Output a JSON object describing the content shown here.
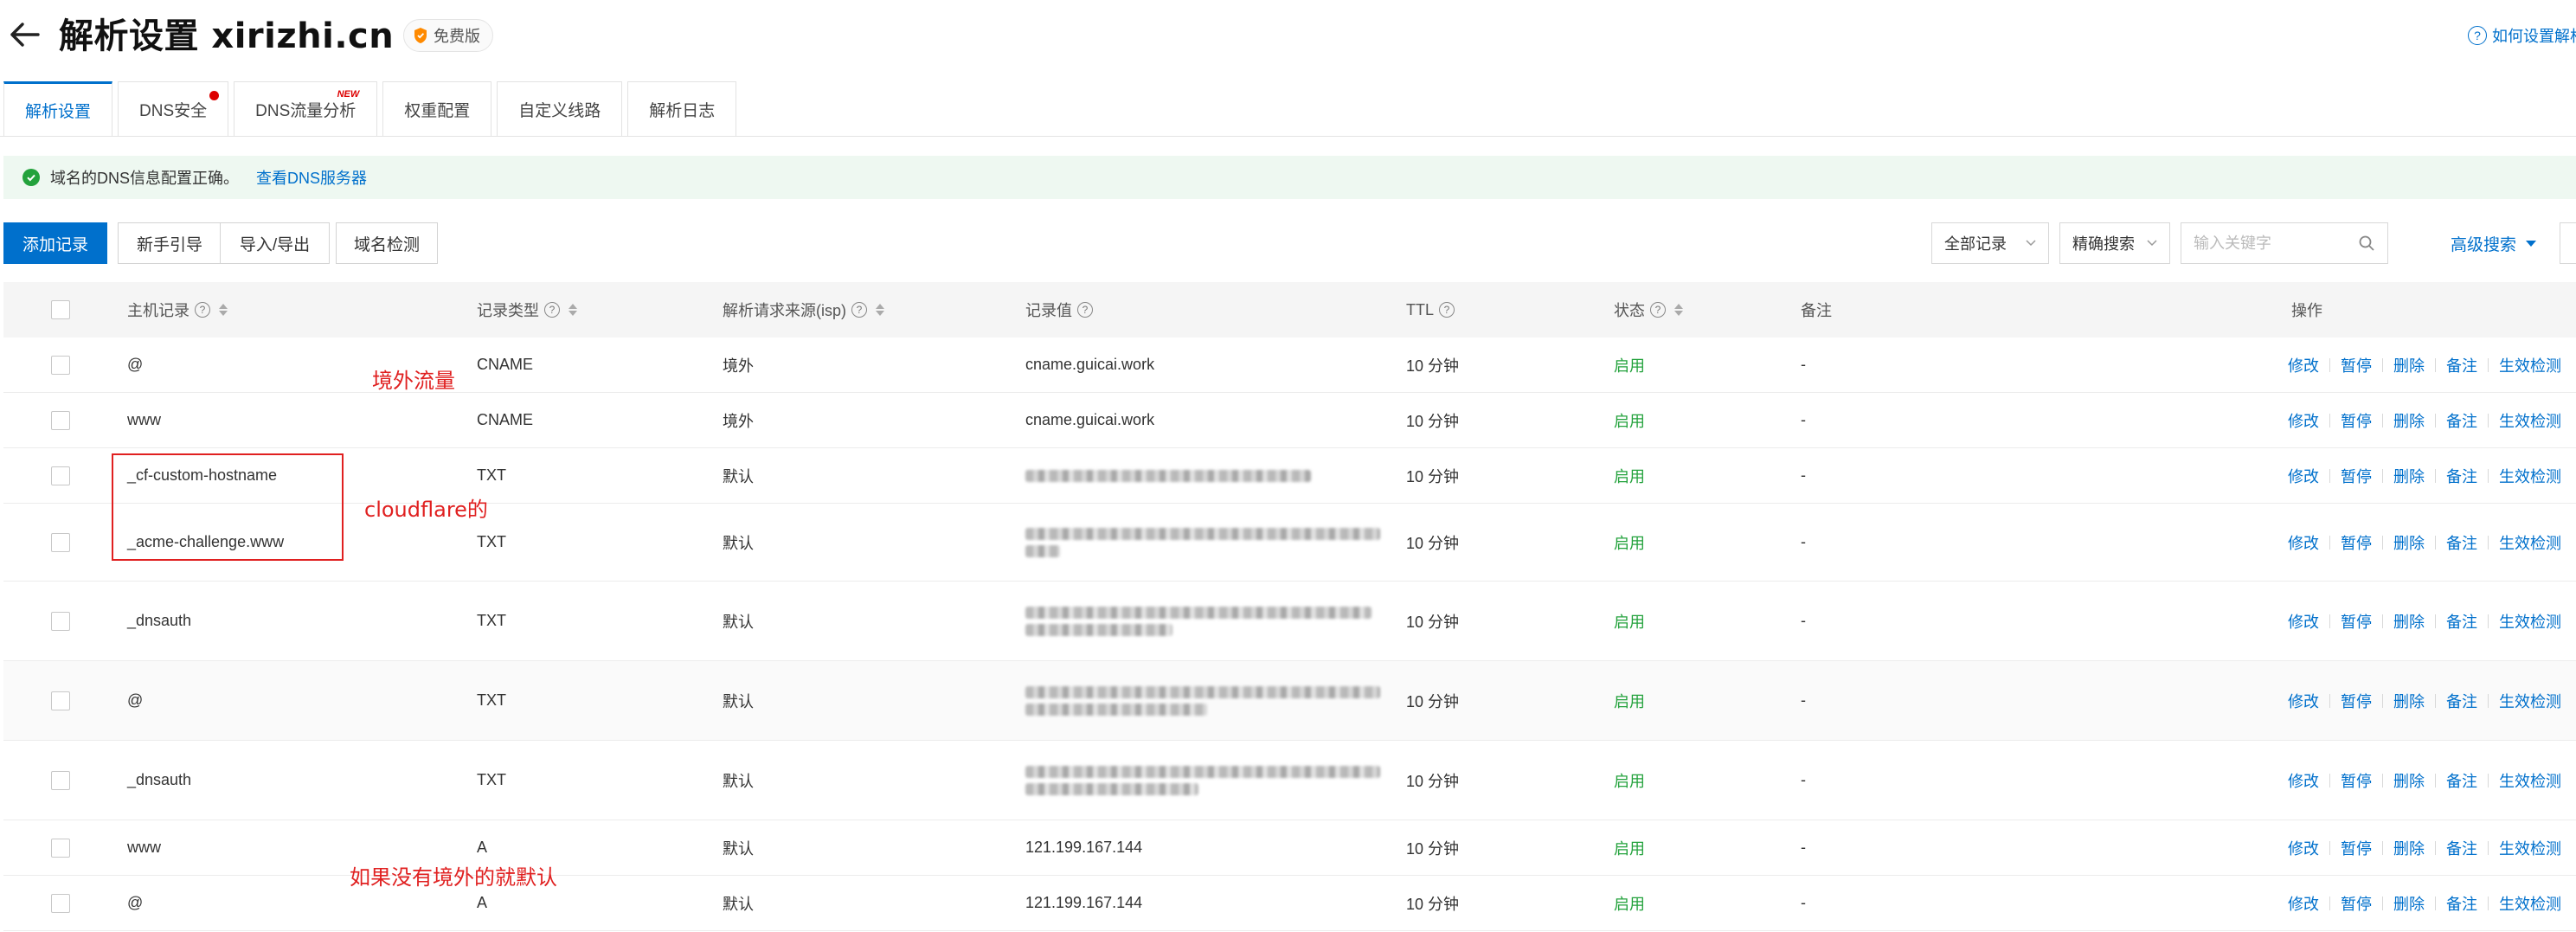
{
  "header": {
    "title": "解析设置 xirizhi.cn",
    "badge": "免费版",
    "help_link": "如何设置解析"
  },
  "tabs": [
    {
      "label": "解析设置",
      "active": true
    },
    {
      "label": "DNS安全",
      "dot": true
    },
    {
      "label": "DNS流量分析",
      "tag": "NEW"
    },
    {
      "label": "权重配置"
    },
    {
      "label": "自定义线路"
    },
    {
      "label": "解析日志"
    }
  ],
  "alert": {
    "text": "域名的DNS信息配置正确。",
    "link": "查看DNS服务器"
  },
  "toolbar": {
    "add": "添加记录",
    "guide": "新手引导",
    "import_export": "导入/导出",
    "check": "域名检测",
    "filter_all": "全部记录",
    "precise_search": "精确搜索",
    "search_placeholder": "输入关键字",
    "advanced_search": "高级搜索"
  },
  "table": {
    "headers": {
      "host": "主机记录",
      "type": "记录类型",
      "source": "解析请求来源(isp)",
      "value": "记录值",
      "ttl": "TTL",
      "status": "状态",
      "remark": "备注",
      "ops": "操作"
    },
    "ops": [
      "修改",
      "暂停",
      "删除",
      "备注",
      "生效检测"
    ],
    "rows": [
      {
        "host": "@",
        "type": "CNAME",
        "source": "境外",
        "value": "cname.guicai.work",
        "ttl": "10 分钟",
        "status": "启用",
        "remark": "-"
      },
      {
        "host": "www",
        "type": "CNAME",
        "source": "境外",
        "value": "cname.guicai.work",
        "ttl": "10 分钟",
        "status": "启用",
        "remark": "-"
      },
      {
        "host": "_cf-custom-hostname",
        "type": "TXT",
        "source": "默认",
        "value": "",
        "ttl": "10 分钟",
        "status": "启用",
        "remark": "-"
      },
      {
        "host": "_acme-challenge.www",
        "type": "TXT",
        "source": "默认",
        "value": "",
        "ttl": "10 分钟",
        "status": "启用",
        "remark": "-"
      },
      {
        "host": "_dnsauth",
        "type": "TXT",
        "source": "默认",
        "value": "",
        "ttl": "10 分钟",
        "status": "启用",
        "remark": "-"
      },
      {
        "host": "@",
        "type": "TXT",
        "source": "默认",
        "value": "",
        "ttl": "10 分钟",
        "status": "启用",
        "remark": "-"
      },
      {
        "host": "_dnsauth",
        "type": "TXT",
        "source": "默认",
        "value": "",
        "ttl": "10 分钟",
        "status": "启用",
        "remark": "-"
      },
      {
        "host": "www",
        "type": "A",
        "source": "默认",
        "value": "121.199.167.144",
        "ttl": "10 分钟",
        "status": "启用",
        "remark": "-"
      },
      {
        "host": "@",
        "type": "A",
        "source": "默认",
        "value": "121.199.167.144",
        "ttl": "10 分钟",
        "status": "启用",
        "remark": "-"
      }
    ]
  },
  "annotations": {
    "overseas": "境外流量",
    "cloudflare": "cloudflare的",
    "default_note": "如果没有境外的就默认"
  },
  "colors": {
    "accent": "#0070cc",
    "status_green": "#23a23c",
    "annotation_red": "#e02020"
  }
}
